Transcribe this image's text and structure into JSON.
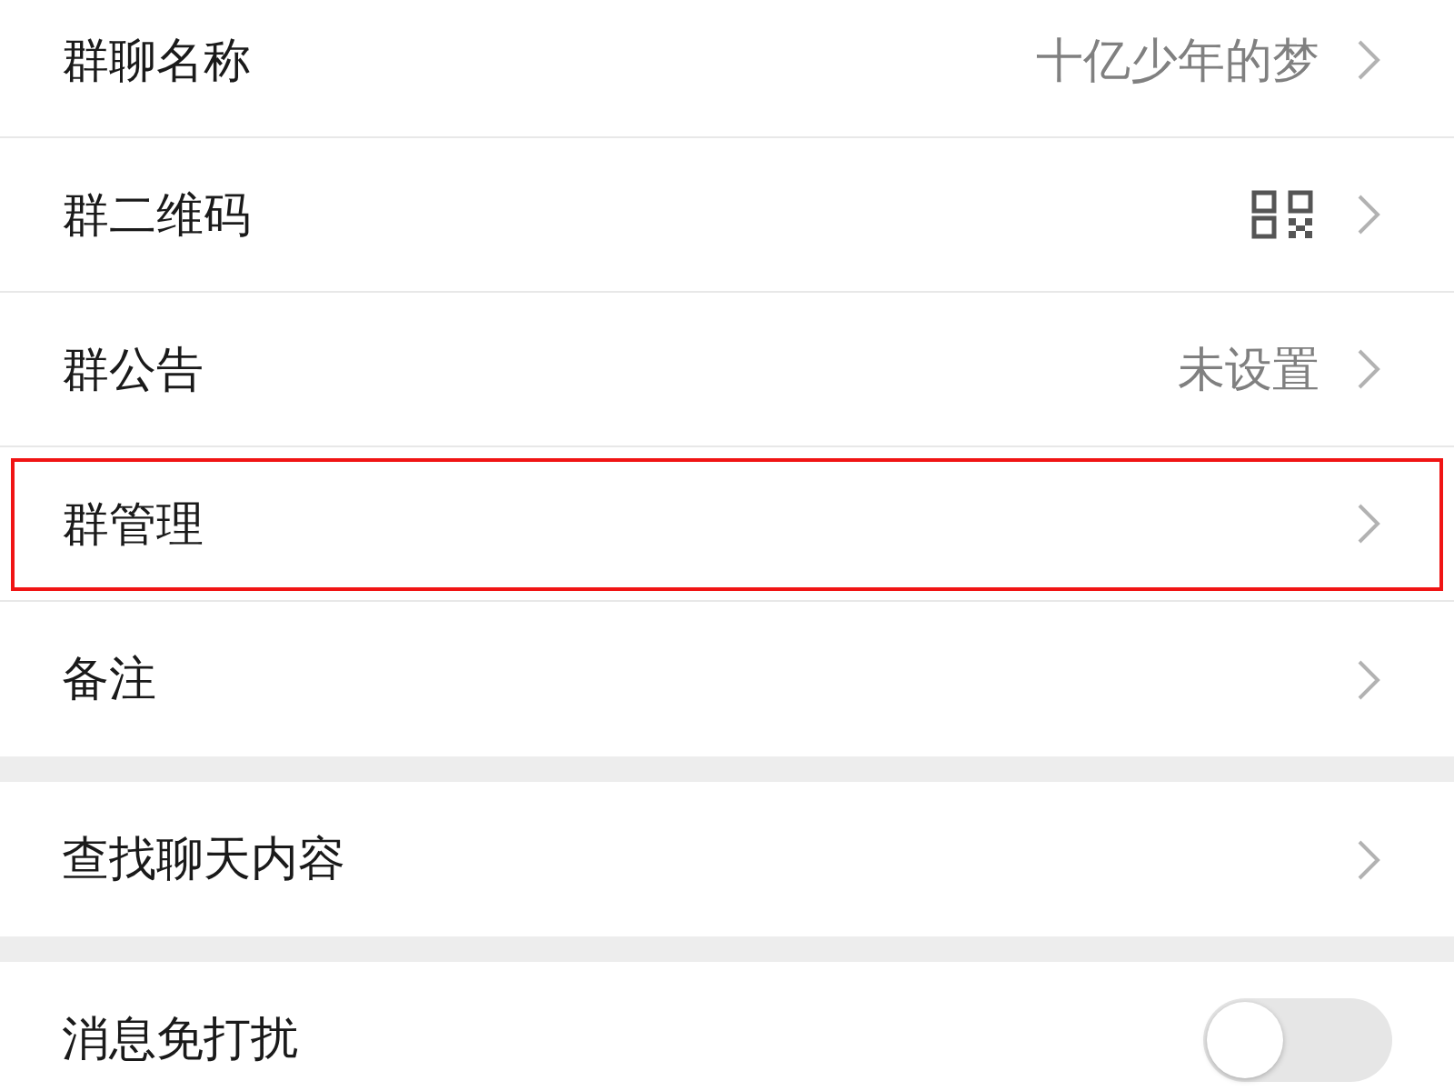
{
  "groups": [
    {
      "items": [
        {
          "kind": "value",
          "label": "群聊名称",
          "value": "十亿少年的梦",
          "highlighted": false
        },
        {
          "kind": "qr",
          "label": "群二维码",
          "highlighted": false
        },
        {
          "kind": "value",
          "label": "群公告",
          "value": "未设置",
          "highlighted": false
        },
        {
          "kind": "plain",
          "label": "群管理",
          "highlighted": true
        },
        {
          "kind": "plain",
          "label": "备注",
          "highlighted": false
        }
      ]
    },
    {
      "items": [
        {
          "kind": "plain",
          "label": "查找聊天内容",
          "highlighted": false
        }
      ]
    },
    {
      "items": [
        {
          "kind": "toggle",
          "label": "消息免打扰",
          "on": false,
          "highlighted": false
        }
      ]
    }
  ]
}
